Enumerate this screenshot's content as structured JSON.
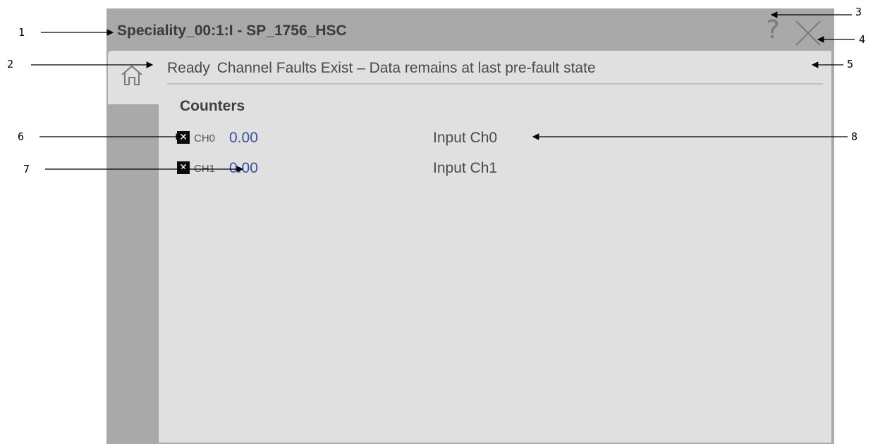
{
  "window": {
    "title": "Speciality_00:1:I - SP_1756_HSC",
    "help_glyph": "?",
    "help_icon": "question-mark-icon",
    "close_icon": "close-x-icon",
    "home_icon": "home-icon"
  },
  "status": {
    "state": "Ready",
    "message": "Channel Faults Exist – Data remains at last pre-fault state"
  },
  "counters": {
    "title": "Counters",
    "channels": [
      {
        "fault_glyph": "✕",
        "label": "CH0",
        "value": "0.00",
        "description": "Input Ch0"
      },
      {
        "fault_glyph": "✕",
        "label": "CH1",
        "value": "0.00",
        "description": "Input Ch1"
      }
    ]
  },
  "callouts": [
    "1",
    "2",
    "3",
    "4",
    "5",
    "6",
    "7",
    "8"
  ],
  "colors": {
    "titlebar": "#a9a9a9",
    "content_bg": "#e0e0e0",
    "value_text": "#3c4fa0",
    "fault_box": "#0b0b0b"
  }
}
